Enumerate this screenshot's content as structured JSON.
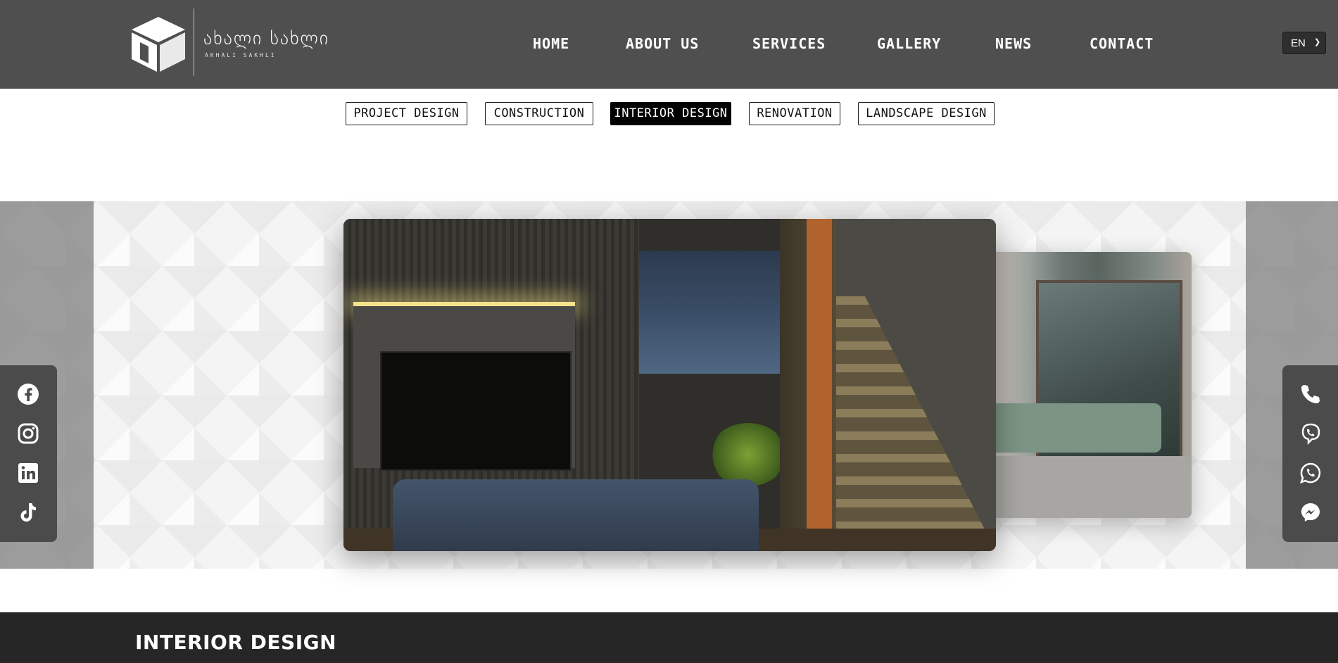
{
  "brand": {
    "name": "ახალი სახლი",
    "subtitle": "AKHALI SAKHLI"
  },
  "nav": {
    "items": [
      {
        "label": "HOME"
      },
      {
        "label": "ABOUT US"
      },
      {
        "label": "SERVICES"
      },
      {
        "label": "GALLERY"
      },
      {
        "label": "NEWS"
      },
      {
        "label": "CONTACT"
      }
    ],
    "language": "EN"
  },
  "categories": {
    "active": "INTERIOR DESIGN",
    "items": [
      {
        "label": "PROJECT DESIGN"
      },
      {
        "label": "CONSTRUCTION"
      },
      {
        "label": "INTERIOR DESIGN"
      },
      {
        "label": "RENOVATION"
      },
      {
        "label": "LANDSCAPE DESIGN"
      }
    ]
  },
  "social_icons": [
    "facebook-icon",
    "instagram-icon",
    "linkedin-icon",
    "tiktok-icon"
  ],
  "contact_icons": [
    "phone-icon",
    "viber-icon",
    "whatsapp-icon",
    "messenger-icon"
  ],
  "section": {
    "title": "INTERIOR DESIGN"
  },
  "colors": {
    "header_bg": "#4f4f4f",
    "footer_bg": "#262626",
    "active_tab_bg": "#000000",
    "accent_orange": "#b1632d"
  }
}
